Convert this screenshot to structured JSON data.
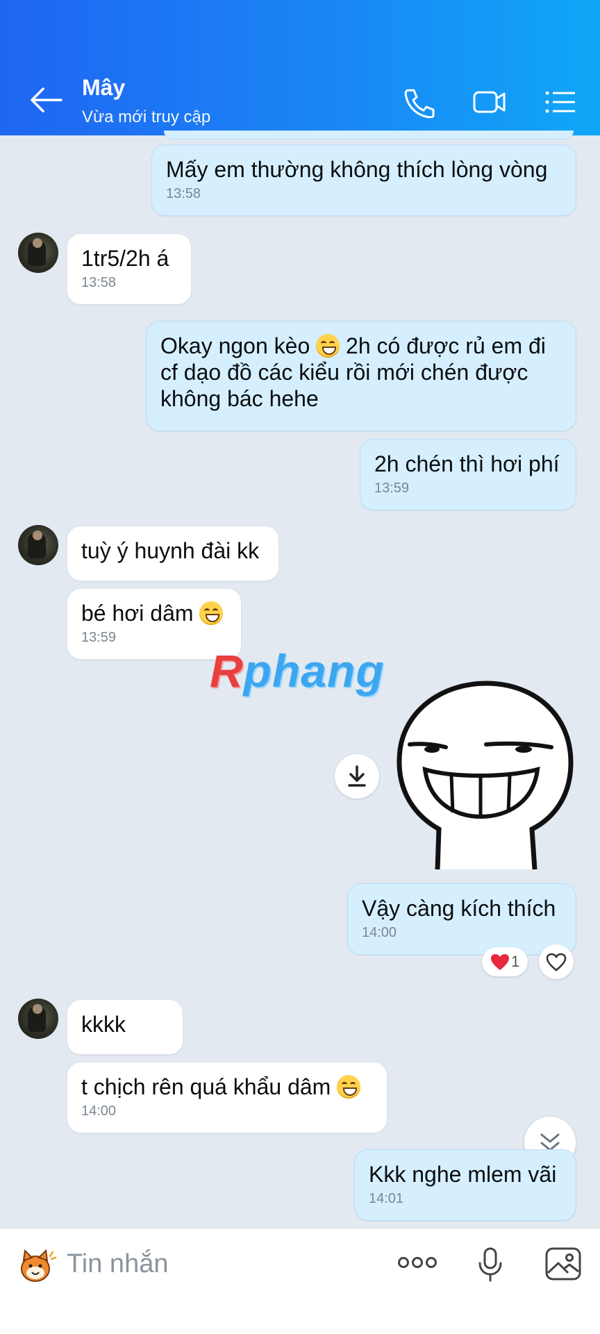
{
  "header": {
    "title": "Mây",
    "subtitle": "Vừa mới truy cập"
  },
  "messages": [
    {
      "dir": "sent",
      "text": "Mấy em thường không thích lòng vòng",
      "time": "13:58"
    },
    {
      "dir": "recv",
      "text": "1tr5/2h á",
      "time": "13:58"
    },
    {
      "dir": "sent",
      "text_before": "Okay ngon kèo ",
      "text_after": " 2h có được rủ em đi\ncf dạo đồ các kiểu rồi mới chén được\nkhông bác hehe",
      "emoji": "laughing-emoji"
    },
    {
      "dir": "sent",
      "text": "2h chén thì hơi phí",
      "time": "13:59"
    },
    {
      "dir": "recv",
      "text": "tuỳ ý huynh đài kk"
    },
    {
      "dir": "recv",
      "text": "bé hơi dâm ",
      "emoji": "laughing-emoji",
      "time": "13:59"
    },
    {
      "dir": "sent",
      "text": "Vậy càng kích thích",
      "time": "14:00"
    },
    {
      "dir": "recv",
      "text": "kkkk"
    },
    {
      "dir": "recv",
      "text": "t chịch rên quá khẩu dâm ",
      "emoji": "laughing-emoji",
      "time": "14:00"
    },
    {
      "dir": "sent",
      "text": "Kkk nghe mlem vãi",
      "time": "14:01"
    }
  ],
  "reaction": {
    "icon": "heart-icon",
    "count": "1"
  },
  "watermark": {
    "first": "R",
    "rest": "phang"
  },
  "input": {
    "placeholder": "Tin nhắn"
  },
  "colors": {
    "header_start": "#1f66f2",
    "header_end": "#10a7f7",
    "sent_bubble": "#d5efff",
    "recv_bubble": "#ffffff",
    "chat_bg": "#e2e9f1"
  }
}
